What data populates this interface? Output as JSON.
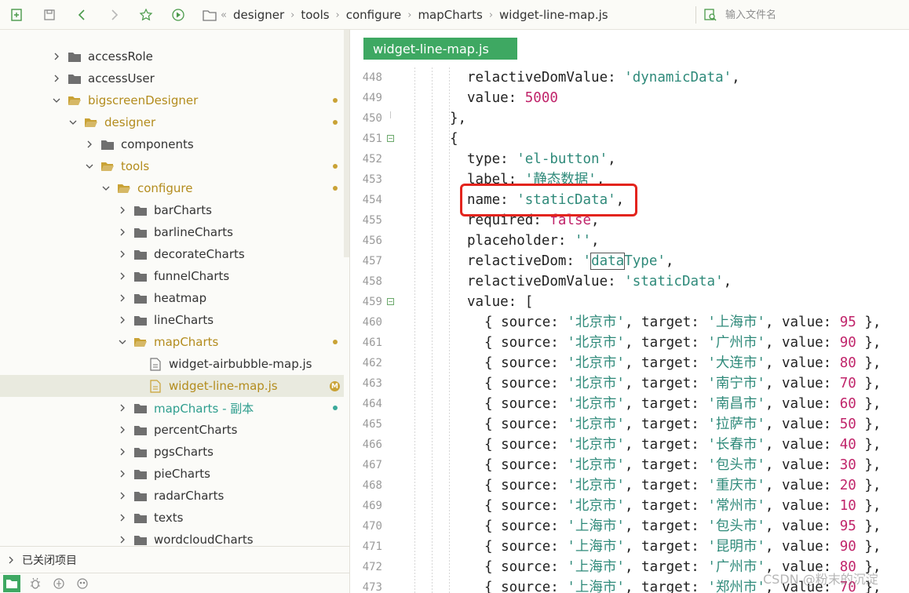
{
  "toolbar": {
    "breadcrumb": [
      "designer",
      "tools",
      "configure",
      "mapCharts",
      "widget-line-map.js"
    ],
    "file_search_placeholder": "输入文件名"
  },
  "sidebar": {
    "tree": [
      {
        "label": "accessRole",
        "indent": 0,
        "kind": "folder",
        "expanded": false,
        "status": ""
      },
      {
        "label": "accessUser",
        "indent": 0,
        "kind": "folder",
        "expanded": false,
        "status": ""
      },
      {
        "label": "bigscreenDesigner",
        "indent": 0,
        "kind": "folder",
        "expanded": true,
        "status": "modified"
      },
      {
        "label": "designer",
        "indent": 1,
        "kind": "folder",
        "expanded": true,
        "status": "modified"
      },
      {
        "label": "components",
        "indent": 2,
        "kind": "folder",
        "expanded": false,
        "status": ""
      },
      {
        "label": "tools",
        "indent": 2,
        "kind": "folder",
        "expanded": true,
        "status": "modified"
      },
      {
        "label": "configure",
        "indent": 3,
        "kind": "folder",
        "expanded": true,
        "status": "modified"
      },
      {
        "label": "barCharts",
        "indent": 4,
        "kind": "folder",
        "expanded": false,
        "status": ""
      },
      {
        "label": "barlineCharts",
        "indent": 4,
        "kind": "folder",
        "expanded": false,
        "status": ""
      },
      {
        "label": "decorateCharts",
        "indent": 4,
        "kind": "folder",
        "expanded": false,
        "status": ""
      },
      {
        "label": "funnelCharts",
        "indent": 4,
        "kind": "folder",
        "expanded": false,
        "status": ""
      },
      {
        "label": "heatmap",
        "indent": 4,
        "kind": "folder",
        "expanded": false,
        "status": ""
      },
      {
        "label": "lineCharts",
        "indent": 4,
        "kind": "folder",
        "expanded": false,
        "status": ""
      },
      {
        "label": "mapCharts",
        "indent": 4,
        "kind": "folder",
        "expanded": true,
        "status": "modified"
      },
      {
        "label": "widget-airbubble-map.js",
        "indent": 5,
        "kind": "file",
        "expanded": false,
        "status": ""
      },
      {
        "label": "widget-line-map.js",
        "indent": 5,
        "kind": "file",
        "expanded": false,
        "status": "M",
        "selected": true
      },
      {
        "label": "mapCharts - 副本",
        "indent": 4,
        "kind": "folder",
        "expanded": false,
        "status": "new"
      },
      {
        "label": "percentCharts",
        "indent": 4,
        "kind": "folder",
        "expanded": false,
        "status": ""
      },
      {
        "label": "pgsCharts",
        "indent": 4,
        "kind": "folder",
        "expanded": false,
        "status": ""
      },
      {
        "label": "pieCharts",
        "indent": 4,
        "kind": "folder",
        "expanded": false,
        "status": ""
      },
      {
        "label": "radarCharts",
        "indent": 4,
        "kind": "folder",
        "expanded": false,
        "status": ""
      },
      {
        "label": "texts",
        "indent": 4,
        "kind": "folder",
        "expanded": false,
        "status": ""
      },
      {
        "label": "wordcloudCharts",
        "indent": 4,
        "kind": "folder",
        "expanded": false,
        "status": ""
      }
    ],
    "closed_projects_label": "已关闭项目"
  },
  "editor": {
    "active_tab": "widget-line-map.js",
    "lines": [
      {
        "num": "448",
        "fold": "",
        "indent": 1,
        "tokens": [
          [
            "k",
            "relactiveDomValue: "
          ],
          [
            "s",
            "'dynamicData'"
          ],
          [
            "p",
            ","
          ]
        ]
      },
      {
        "num": "449",
        "fold": "",
        "indent": 1,
        "tokens": [
          [
            "k",
            "value: "
          ],
          [
            "n",
            "5000"
          ]
        ]
      },
      {
        "num": "450",
        "fold": "end",
        "indent": 0,
        "tokens": [
          [
            "p",
            "},"
          ]
        ]
      },
      {
        "num": "451",
        "fold": "open",
        "indent": 0,
        "tokens": [
          [
            "p",
            "{"
          ]
        ]
      },
      {
        "num": "452",
        "fold": "",
        "indent": 1,
        "tokens": [
          [
            "k",
            "type: "
          ],
          [
            "s",
            "'el-button'"
          ],
          [
            "p",
            ","
          ]
        ]
      },
      {
        "num": "453",
        "fold": "",
        "indent": 1,
        "tokens": [
          [
            "k",
            "label: "
          ],
          [
            "s",
            "'静态数据'"
          ],
          [
            "p",
            ","
          ]
        ]
      },
      {
        "num": "454",
        "fold": "",
        "indent": 1,
        "tokens": [
          [
            "k",
            "name: "
          ],
          [
            "s",
            "'staticData'"
          ],
          [
            "p",
            ","
          ]
        ]
      },
      {
        "num": "455",
        "fold": "",
        "indent": 1,
        "tokens": [
          [
            "k",
            "required: "
          ],
          [
            "n",
            "false"
          ],
          [
            "p",
            ","
          ]
        ]
      },
      {
        "num": "456",
        "fold": "",
        "indent": 1,
        "tokens": [
          [
            "k",
            "placeholder: "
          ],
          [
            "s",
            "''"
          ],
          [
            "p",
            ","
          ]
        ]
      },
      {
        "num": "457",
        "fold": "",
        "indent": 1,
        "tokens": [
          [
            "k",
            "relactiveDom: "
          ],
          [
            "s",
            "'"
          ],
          [
            "sbox",
            "data"
          ],
          [
            "s",
            "Type'"
          ],
          [
            "p",
            ","
          ]
        ]
      },
      {
        "num": "458",
        "fold": "",
        "indent": 1,
        "tokens": [
          [
            "k",
            "relactiveDomValue: "
          ],
          [
            "s",
            "'staticData'"
          ],
          [
            "p",
            ","
          ]
        ]
      },
      {
        "num": "459",
        "fold": "open",
        "indent": 1,
        "tokens": [
          [
            "k",
            "value: ["
          ]
        ]
      },
      {
        "num": "460",
        "fold": "",
        "indent": 2,
        "tokens": [
          [
            "p",
            "{ "
          ],
          [
            "k",
            "source: "
          ],
          [
            "s",
            "'北京市'"
          ],
          [
            "p",
            ", "
          ],
          [
            "k",
            "target: "
          ],
          [
            "s",
            "'上海市'"
          ],
          [
            "p",
            ", "
          ],
          [
            "k",
            "value: "
          ],
          [
            "n",
            "95"
          ],
          [
            "p",
            " },"
          ]
        ]
      },
      {
        "num": "461",
        "fold": "",
        "indent": 2,
        "tokens": [
          [
            "p",
            "{ "
          ],
          [
            "k",
            "source: "
          ],
          [
            "s",
            "'北京市'"
          ],
          [
            "p",
            ", "
          ],
          [
            "k",
            "target: "
          ],
          [
            "s",
            "'广州市'"
          ],
          [
            "p",
            ", "
          ],
          [
            "k",
            "value: "
          ],
          [
            "n",
            "90"
          ],
          [
            "p",
            " },"
          ]
        ]
      },
      {
        "num": "462",
        "fold": "",
        "indent": 2,
        "tokens": [
          [
            "p",
            "{ "
          ],
          [
            "k",
            "source: "
          ],
          [
            "s",
            "'北京市'"
          ],
          [
            "p",
            ", "
          ],
          [
            "k",
            "target: "
          ],
          [
            "s",
            "'大连市'"
          ],
          [
            "p",
            ", "
          ],
          [
            "k",
            "value: "
          ],
          [
            "n",
            "80"
          ],
          [
            "p",
            " },"
          ]
        ]
      },
      {
        "num": "463",
        "fold": "",
        "indent": 2,
        "tokens": [
          [
            "p",
            "{ "
          ],
          [
            "k",
            "source: "
          ],
          [
            "s",
            "'北京市'"
          ],
          [
            "p",
            ", "
          ],
          [
            "k",
            "target: "
          ],
          [
            "s",
            "'南宁市'"
          ],
          [
            "p",
            ", "
          ],
          [
            "k",
            "value: "
          ],
          [
            "n",
            "70"
          ],
          [
            "p",
            " },"
          ]
        ]
      },
      {
        "num": "464",
        "fold": "",
        "indent": 2,
        "tokens": [
          [
            "p",
            "{ "
          ],
          [
            "k",
            "source: "
          ],
          [
            "s",
            "'北京市'"
          ],
          [
            "p",
            ", "
          ],
          [
            "k",
            "target: "
          ],
          [
            "s",
            "'南昌市'"
          ],
          [
            "p",
            ", "
          ],
          [
            "k",
            "value: "
          ],
          [
            "n",
            "60"
          ],
          [
            "p",
            " },"
          ]
        ]
      },
      {
        "num": "465",
        "fold": "",
        "indent": 2,
        "tokens": [
          [
            "p",
            "{ "
          ],
          [
            "k",
            "source: "
          ],
          [
            "s",
            "'北京市'"
          ],
          [
            "p",
            ", "
          ],
          [
            "k",
            "target: "
          ],
          [
            "s",
            "'拉萨市'"
          ],
          [
            "p",
            ", "
          ],
          [
            "k",
            "value: "
          ],
          [
            "n",
            "50"
          ],
          [
            "p",
            " },"
          ]
        ]
      },
      {
        "num": "466",
        "fold": "",
        "indent": 2,
        "tokens": [
          [
            "p",
            "{ "
          ],
          [
            "k",
            "source: "
          ],
          [
            "s",
            "'北京市'"
          ],
          [
            "p",
            ", "
          ],
          [
            "k",
            "target: "
          ],
          [
            "s",
            "'长春市'"
          ],
          [
            "p",
            ", "
          ],
          [
            "k",
            "value: "
          ],
          [
            "n",
            "40"
          ],
          [
            "p",
            " },"
          ]
        ]
      },
      {
        "num": "467",
        "fold": "",
        "indent": 2,
        "tokens": [
          [
            "p",
            "{ "
          ],
          [
            "k",
            "source: "
          ],
          [
            "s",
            "'北京市'"
          ],
          [
            "p",
            ", "
          ],
          [
            "k",
            "target: "
          ],
          [
            "s",
            "'包头市'"
          ],
          [
            "p",
            ", "
          ],
          [
            "k",
            "value: "
          ],
          [
            "n",
            "30"
          ],
          [
            "p",
            " },"
          ]
        ]
      },
      {
        "num": "468",
        "fold": "",
        "indent": 2,
        "tokens": [
          [
            "p",
            "{ "
          ],
          [
            "k",
            "source: "
          ],
          [
            "s",
            "'北京市'"
          ],
          [
            "p",
            ", "
          ],
          [
            "k",
            "target: "
          ],
          [
            "s",
            "'重庆市'"
          ],
          [
            "p",
            ", "
          ],
          [
            "k",
            "value: "
          ],
          [
            "n",
            "20"
          ],
          [
            "p",
            " },"
          ]
        ]
      },
      {
        "num": "469",
        "fold": "",
        "indent": 2,
        "tokens": [
          [
            "p",
            "{ "
          ],
          [
            "k",
            "source: "
          ],
          [
            "s",
            "'北京市'"
          ],
          [
            "p",
            ", "
          ],
          [
            "k",
            "target: "
          ],
          [
            "s",
            "'常州市'"
          ],
          [
            "p",
            ", "
          ],
          [
            "k",
            "value: "
          ],
          [
            "n",
            "10"
          ],
          [
            "p",
            " },"
          ]
        ]
      },
      {
        "num": "470",
        "fold": "",
        "indent": 2,
        "tokens": [
          [
            "p",
            "{ "
          ],
          [
            "k",
            "source: "
          ],
          [
            "s",
            "'上海市'"
          ],
          [
            "p",
            ", "
          ],
          [
            "k",
            "target: "
          ],
          [
            "s",
            "'包头市'"
          ],
          [
            "p",
            ", "
          ],
          [
            "k",
            "value: "
          ],
          [
            "n",
            "95"
          ],
          [
            "p",
            " },"
          ]
        ]
      },
      {
        "num": "471",
        "fold": "",
        "indent": 2,
        "tokens": [
          [
            "p",
            "{ "
          ],
          [
            "k",
            "source: "
          ],
          [
            "s",
            "'上海市'"
          ],
          [
            "p",
            ", "
          ],
          [
            "k",
            "target: "
          ],
          [
            "s",
            "'昆明市'"
          ],
          [
            "p",
            ", "
          ],
          [
            "k",
            "value: "
          ],
          [
            "n",
            "90"
          ],
          [
            "p",
            " },"
          ]
        ]
      },
      {
        "num": "472",
        "fold": "",
        "indent": 2,
        "tokens": [
          [
            "p",
            "{ "
          ],
          [
            "k",
            "source: "
          ],
          [
            "s",
            "'上海市'"
          ],
          [
            "p",
            ", "
          ],
          [
            "k",
            "target: "
          ],
          [
            "s",
            "'广州市'"
          ],
          [
            "p",
            ", "
          ],
          [
            "k",
            "value: "
          ],
          [
            "n",
            "80"
          ],
          [
            "p",
            " },"
          ]
        ]
      },
      {
        "num": "473",
        "fold": "",
        "indent": 2,
        "tokens": [
          [
            "p",
            "{ "
          ],
          [
            "k",
            "source: "
          ],
          [
            "s",
            "'上海市'"
          ],
          [
            "p",
            ", "
          ],
          [
            "k",
            "target: "
          ],
          [
            "s",
            "'郑州市'"
          ],
          [
            "p",
            ", "
          ],
          [
            "k",
            "value: "
          ],
          [
            "n",
            "70"
          ],
          [
            "p",
            " },"
          ]
        ]
      }
    ]
  },
  "watermark": "CSDN @粉末的沉淀",
  "colors": {
    "accent_green": "#3ea862",
    "modified_gold": "#c9a235",
    "string_teal": "#2f8a7a",
    "number_magenta": "#c0246a",
    "highlight_red": "#e3241d"
  }
}
